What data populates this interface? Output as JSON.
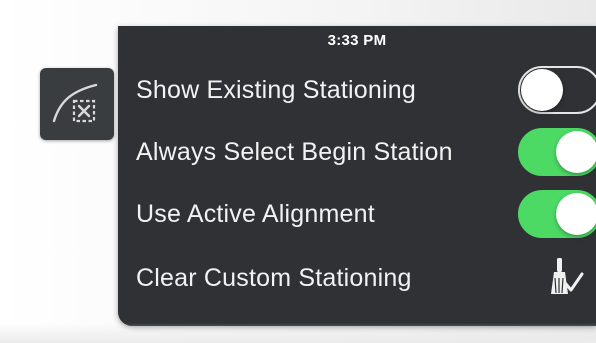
{
  "status_bar": {
    "time": "3:33 PM"
  },
  "tool_button": {
    "icon": "alignment-stationing-icon"
  },
  "settings": [
    {
      "label": "Show Existing Stationing",
      "control": "toggle",
      "state": "off"
    },
    {
      "label": "Always Select Begin Station",
      "control": "toggle",
      "state": "on"
    },
    {
      "label": "Use Active Alignment",
      "control": "toggle",
      "state": "on"
    },
    {
      "label": "Clear Custom Stationing",
      "control": "action",
      "icon": "broom-check-icon"
    }
  ],
  "colors": {
    "panel_bg": "#2f3134",
    "toggle_on": "#4cd964",
    "toggle_off_border": "#e6e6e6",
    "text": "#f2f2f2"
  }
}
